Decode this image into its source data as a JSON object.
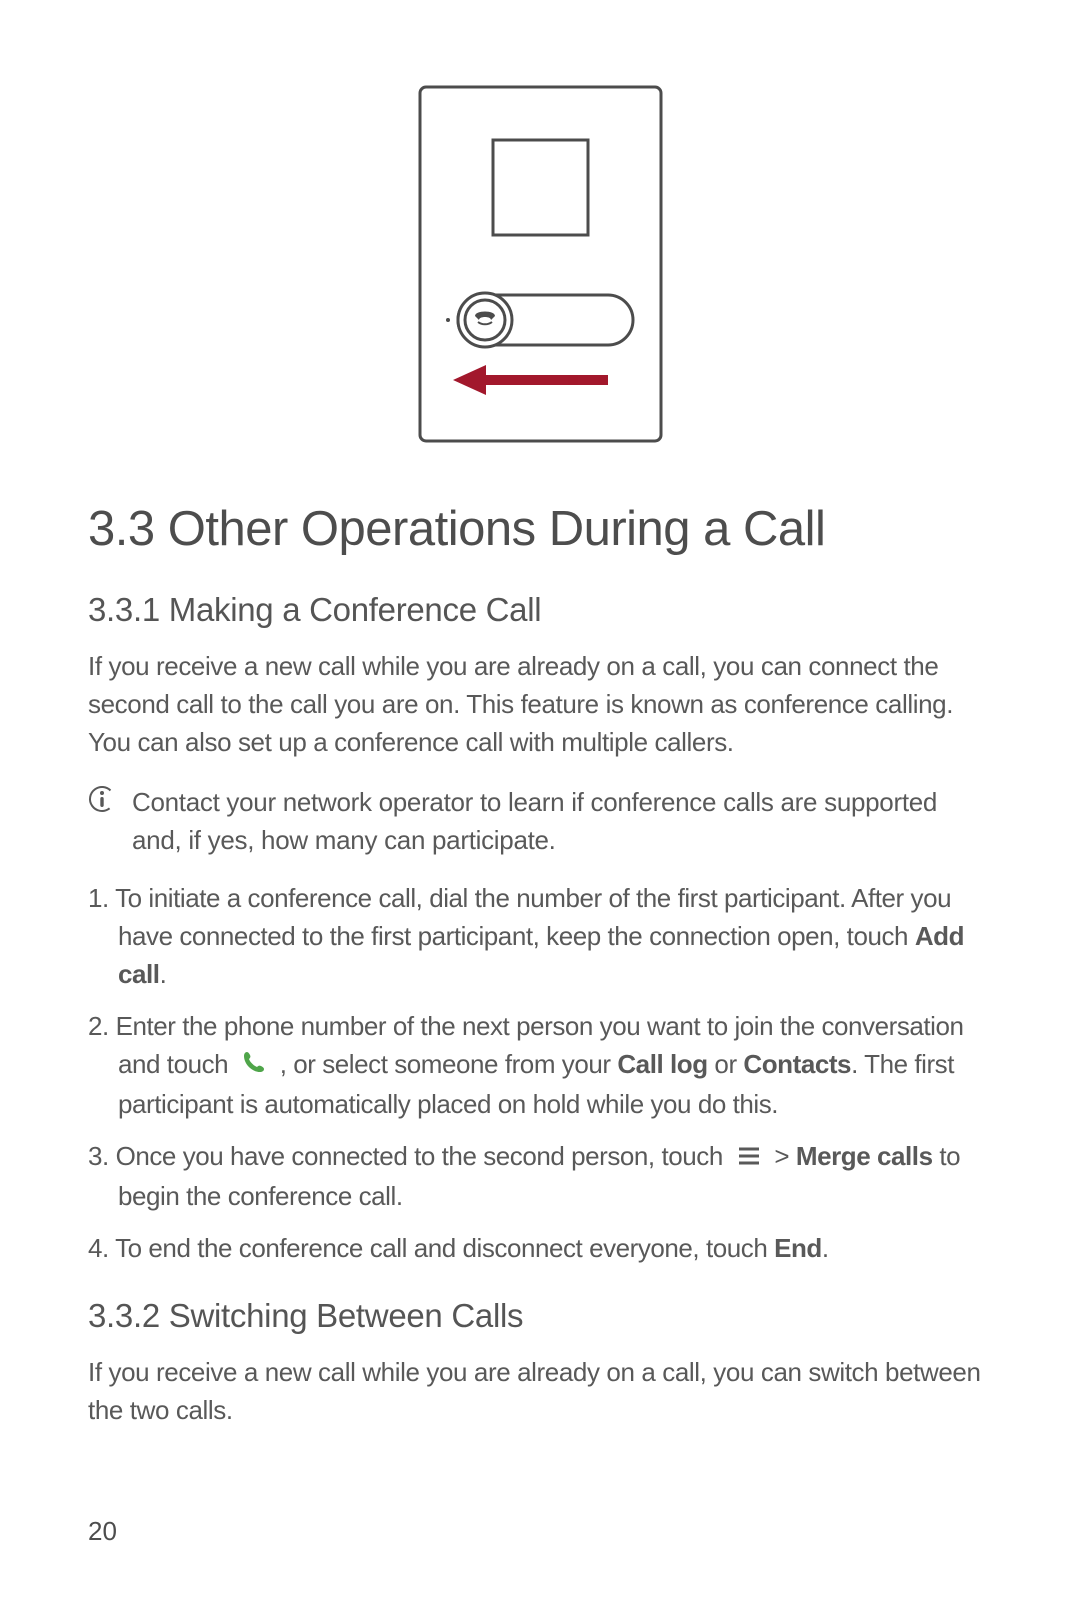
{
  "figure": {
    "slide_arrow_color": "#a2182c"
  },
  "heading": "3.3  Other Operations During a Call",
  "sub1": {
    "title": "3.3.1  Making a Conference Call",
    "intro": "If you receive a new call while you are already on a call, you can connect the second call to the call you are on. This feature is known as conference calling. You can also set up a conference call with multiple callers.",
    "note": "Contact your network operator to learn if conference calls are supported and, if yes, how many can participate.",
    "steps": {
      "s1_a": "To initiate a conference call, dial the number of the first participant. After you have connected to the first participant, keep the connection open, touch ",
      "s1_bold": "Add call",
      "s1_b": ".",
      "s2_a": "Enter the phone number of the next person you want to join the conversation and touch ",
      "s2_b": " , or select someone from your ",
      "s2_bold1": "Call log",
      "s2_c": " or ",
      "s2_bold2": "Contacts",
      "s2_d": ". The first participant is automatically placed on hold while you do this.",
      "s3_a": "Once you have connected to the second person, touch ",
      "s3_b": "  > ",
      "s3_bold": "Merge calls",
      "s3_c": " to begin the conference call.",
      "s4_a": "To end the conference call and disconnect everyone, touch ",
      "s4_bold": "End",
      "s4_b": "."
    }
  },
  "sub2": {
    "title": "3.3.2  Switching Between Calls",
    "intro": "If you receive a new call while you are already on a call, you can switch between the two calls."
  },
  "page_number": "20"
}
